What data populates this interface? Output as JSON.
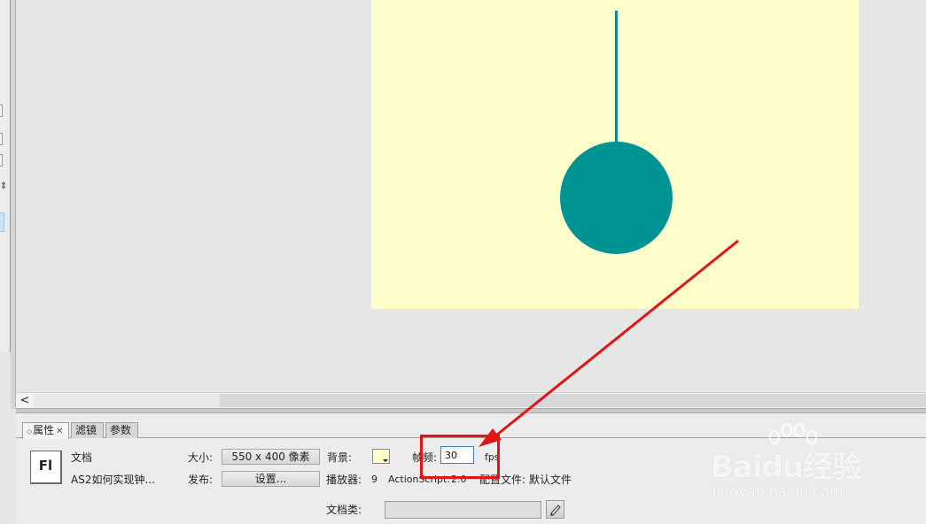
{
  "app": {
    "logo_text": "Fl"
  },
  "scrollbar": {
    "left_arrow": "<"
  },
  "panel": {
    "tabs": [
      {
        "label": "属性",
        "active": true
      },
      {
        "label": "滤镜",
        "active": false
      },
      {
        "label": "参数",
        "active": false
      }
    ],
    "doc_type": "文档",
    "doc_name": "AS2如何实现钟...",
    "size_label": "大小:",
    "size_value": "550 x 400 像素",
    "publish_label": "发布:",
    "settings_button": "设置...",
    "background_label": "背景:",
    "background_color": "#FFFFCC",
    "fps_label": "帧频:",
    "fps_value": "30",
    "fps_unit": "fps",
    "player_label": "播放器:",
    "player_value": "9",
    "actionscript_label": "ActionScript:",
    "actionscript_value": "2.0",
    "profile_label": "配置文件:",
    "profile_value": "默认文件",
    "docclass_label": "文档类:",
    "docclass_value": ""
  },
  "colors": {
    "stage_background": "#FFFFCC",
    "pendulum": "#009393",
    "annotation": "#E01616"
  },
  "watermark": {
    "brand": "Baidu经验",
    "site": "jingyan.baidu.com"
  }
}
